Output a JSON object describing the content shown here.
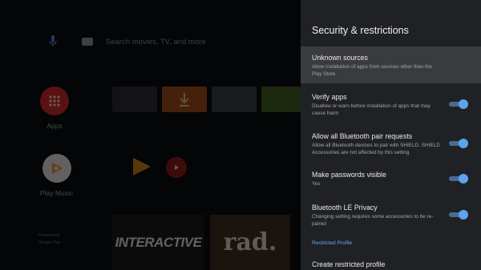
{
  "launcher": {
    "search_hint": "Search movies, TV, and more",
    "apps_label": "Apps",
    "play_music_label": "Play Music",
    "vendor_text": [
      "Powered by",
      "Google Play"
    ],
    "promo1": "INTERACTIVE",
    "promo2": "rad."
  },
  "panel": {
    "title": "Security & restrictions",
    "items": [
      {
        "title": "Unknown sources",
        "subtitle": "Allow installation of apps from sources other than the Play Store"
      },
      {
        "title": "Verify apps",
        "subtitle": "Disallow or warn before installation of apps that may cause harm",
        "toggle_on": true
      },
      {
        "title": "Allow all Bluetooth pair requests",
        "subtitle": "Allow all Bluetooth devices to pair with SHIELD. SHIELD Accessories are not affected by this setting",
        "toggle_on": true
      },
      {
        "title": "Make passwords visible",
        "subtitle": "Yes",
        "toggle_on": true
      },
      {
        "title": "Bluetooth LE Privacy",
        "subtitle": "Changing setting requires some accessories to be re-paired",
        "toggle_on": true
      }
    ],
    "section_label": "Restricted Profile",
    "last_item": {
      "title": "Create restricted profile"
    }
  },
  "colors": {
    "panel_bg": "#202124",
    "focus_bg": "#3a3b3e",
    "accent": "#5ea3ec",
    "section": "#6fa9ea"
  }
}
